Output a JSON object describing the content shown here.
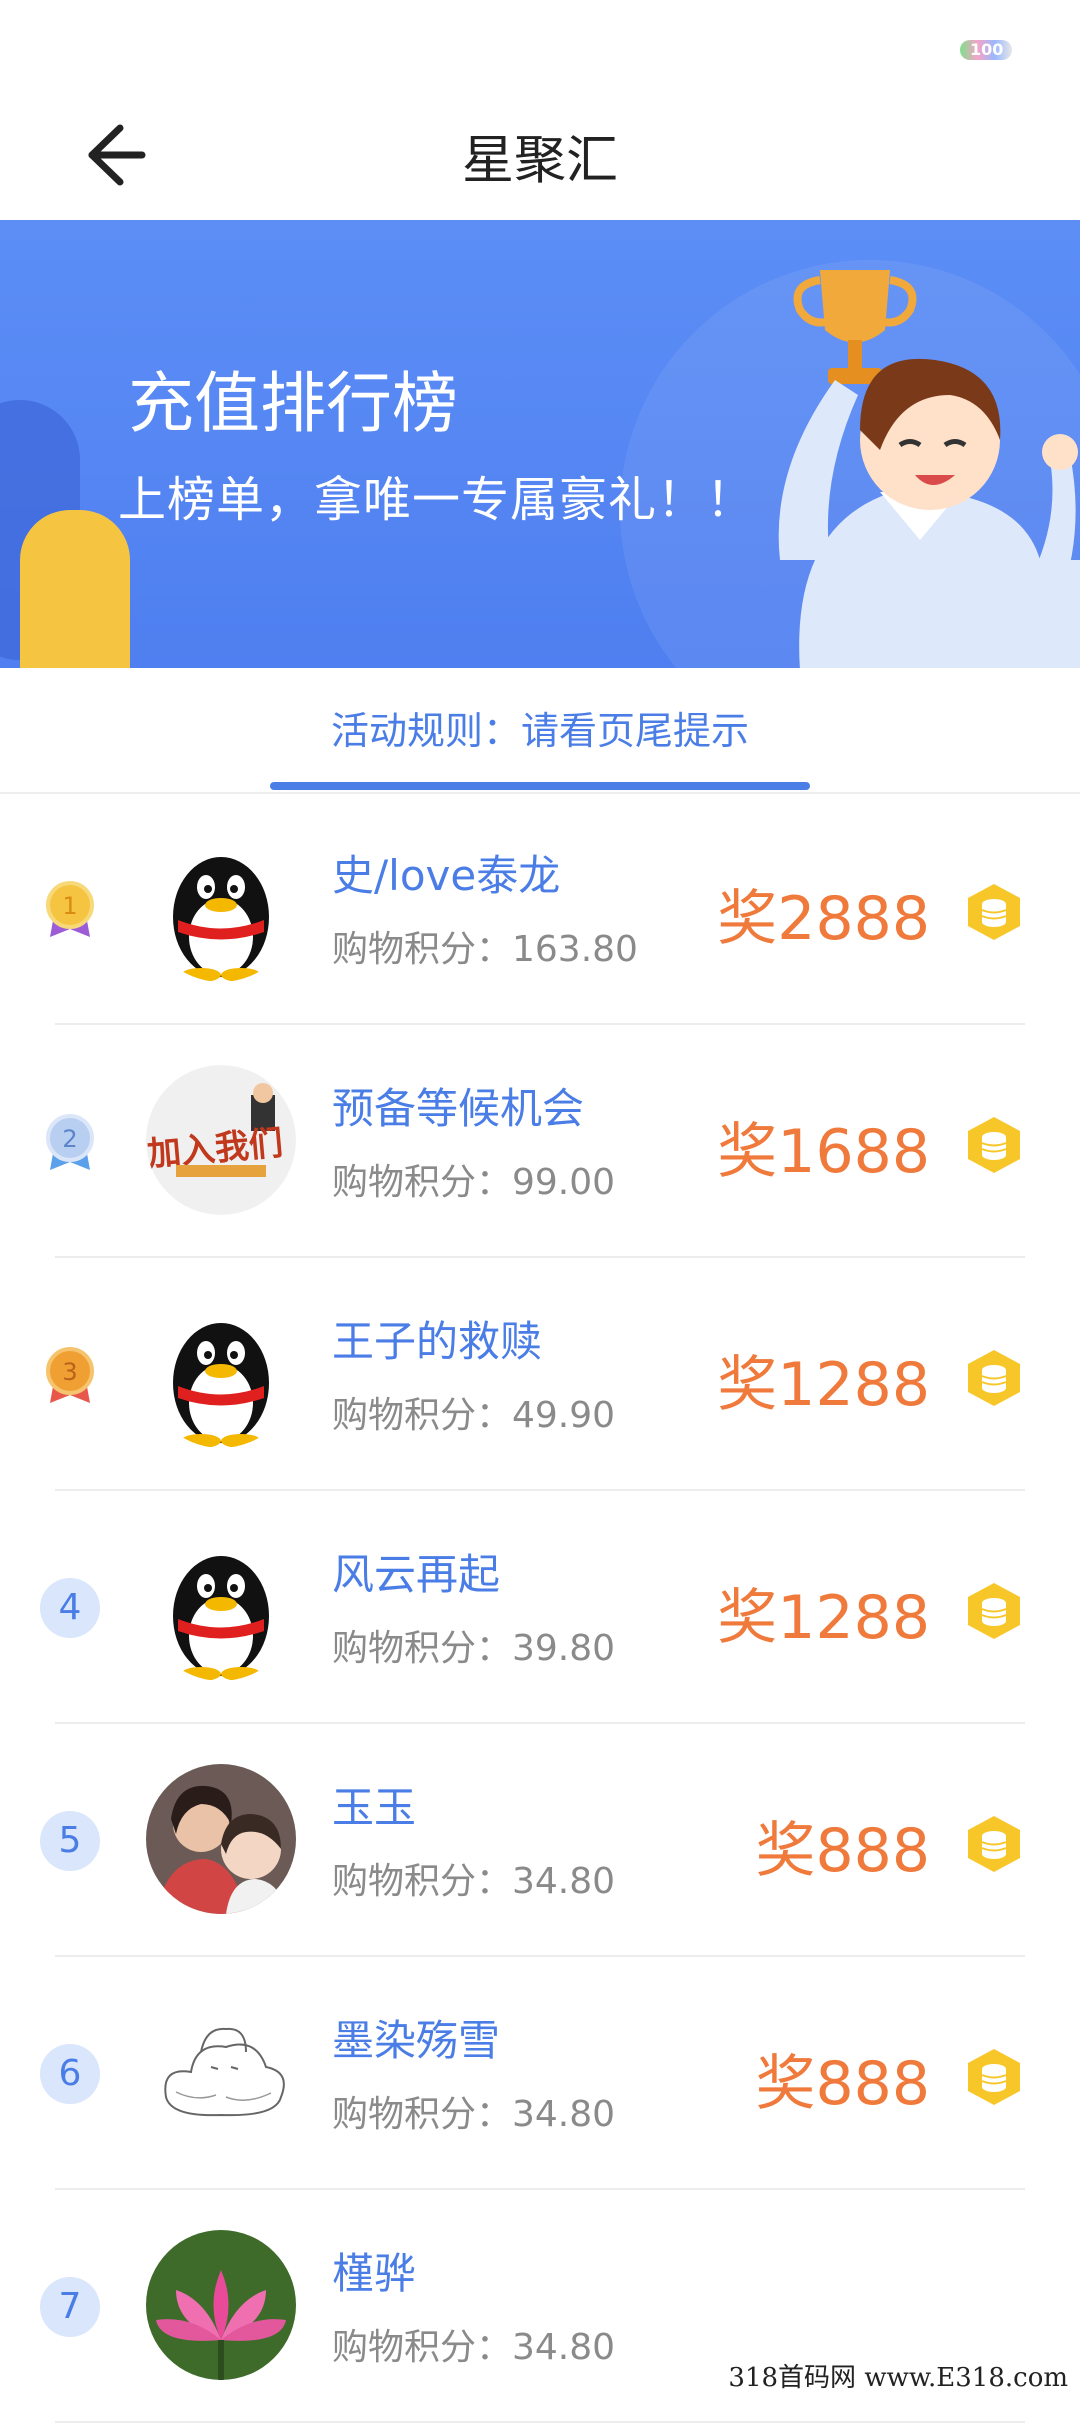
{
  "header": {
    "title": "星聚汇"
  },
  "status_bar": {
    "battery": "100"
  },
  "banner": {
    "title": "充值排行榜",
    "subtitle": "上榜单，拿唯一专属豪礼！！"
  },
  "rules_tab": {
    "label": "活动规则：请看页尾提示"
  },
  "ranking": [
    {
      "rank": "1",
      "name": "史/love泰龙",
      "score": "购物积分：163.80",
      "prize": "奖2888",
      "avatar": "qq-penguin"
    },
    {
      "rank": "2",
      "name": "预备等候机会",
      "score": "购物积分：99.00",
      "prize": "奖1688",
      "avatar": "join-us"
    },
    {
      "rank": "3",
      "name": "王子的救赎",
      "score": "购物积分：49.90",
      "prize": "奖1288",
      "avatar": "qq-penguin"
    },
    {
      "rank": "4",
      "name": "风云再起",
      "score": "购物积分：39.80",
      "prize": "奖1288",
      "avatar": "qq-penguin"
    },
    {
      "rank": "5",
      "name": "玉玉",
      "score": "购物积分：34.80",
      "prize": "奖888",
      "avatar": "photo"
    },
    {
      "rank": "6",
      "name": "墨染殇雪",
      "score": "购物积分：34.80",
      "prize": "奖888",
      "avatar": "sketch"
    },
    {
      "rank": "7",
      "name": "槿骅",
      "score": "购物积分：34.80",
      "prize": "",
      "avatar": "lotus"
    }
  ],
  "colors": {
    "accent": "#4a7de6",
    "prize": "#ef7a3b",
    "banner": "#5c8ef6",
    "gold": "#f5c542",
    "silver": "#a9c4ee",
    "bronze": "#f0a032"
  },
  "watermark": "318首码网 www.E318.com"
}
